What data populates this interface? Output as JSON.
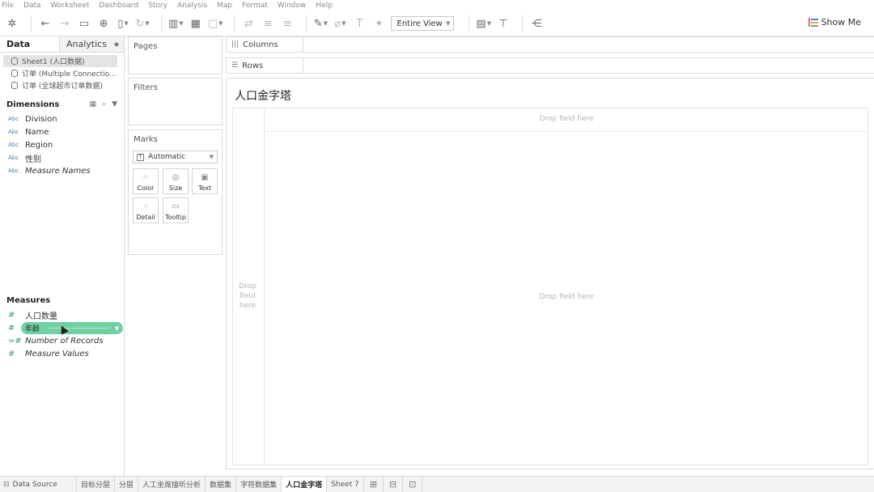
{
  "menu": [
    "File",
    "Data",
    "Worksheet",
    "Dashboard",
    "Story",
    "Analysis",
    "Map",
    "Format",
    "Window",
    "Help"
  ],
  "toolbar": {
    "view_select": "Entire View",
    "show_me": "Show Me"
  },
  "data_pane": {
    "tabs": [
      "Data",
      "Analytics"
    ],
    "sources": [
      "Sheet1 (人口数据)",
      "订单 (Multiple Connectio...",
      "订单 (全球超市订单数据)"
    ],
    "dimensions_title": "Dimensions",
    "dimensions": [
      {
        "label": "Division",
        "type_tag": "Abc",
        "italic": false
      },
      {
        "label": "Name",
        "type_tag": "Abc",
        "italic": false
      },
      {
        "label": "Region",
        "type_tag": "Abc",
        "italic": false
      },
      {
        "label": "性别",
        "type_tag": "Abc",
        "italic": false
      },
      {
        "label": "Measure Names",
        "type_tag": "Abc",
        "italic": true
      }
    ],
    "measures_title": "Measures",
    "measures": [
      {
        "label": "人口数量",
        "italic": false
      },
      {
        "label": "年龄",
        "italic": false,
        "dragging": true
      },
      {
        "label": "Number of Records",
        "italic": true
      },
      {
        "label": "Measure Values",
        "italic": true
      }
    ]
  },
  "cards": {
    "pages": "Pages",
    "filters": "Filters",
    "marks": "Marks",
    "mark_type": "Automatic",
    "mark_buttons": [
      "Color",
      "Size",
      "Text",
      "Detail",
      "Tooltip"
    ]
  },
  "shelves": {
    "columns": "Columns",
    "rows": "Rows"
  },
  "view": {
    "title": "人口金字塔",
    "drop_top": "Drop field here",
    "drop_center": "Drop field here",
    "drop_left": "Drop field here"
  },
  "bottom_tabs": {
    "data_source": "Data Source",
    "sheets": [
      "目标分层",
      "分层",
      "人工坐席接听分析",
      "数据集",
      "字符数据集",
      "人口金字塔",
      "Sheet 7"
    ],
    "active_index": 5
  },
  "colors": {
    "pill": "#6fd1a2",
    "dimension_icon": "#4a7ab8",
    "measure_icon": "#3a9a6a"
  }
}
